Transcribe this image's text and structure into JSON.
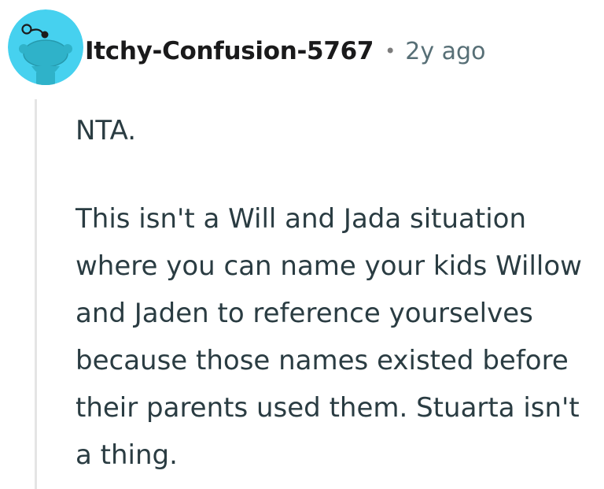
{
  "comment": {
    "author": "Itchy-Confusion-5767",
    "separator": "•",
    "age": "2y ago",
    "avatar_icon": "snoo-avatar-icon",
    "paragraphs": [
      "NTA.",
      "This isn't a Will and Jada situation where you can name your kids Willow and Jaden to reference yourselves because those names existed before their parents used them. Stuarta isn't a thing."
    ]
  },
  "colors": {
    "avatar_bg": "#46d1ef",
    "avatar_figure": "#2fb2c9",
    "username": "#1a1a1b",
    "meta": "#576f76",
    "body_text": "#2a3c42",
    "thread_line": "#e5e5e5"
  }
}
